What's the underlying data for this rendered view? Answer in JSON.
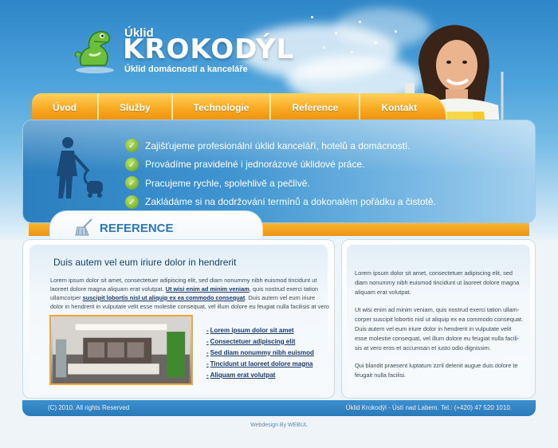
{
  "logo": {
    "small": "Úklid",
    "big": "KROKODÝL",
    "sub": "Úklid domácností a kanceláře"
  },
  "nav": [
    "Úvod",
    "Služby",
    "Technologie",
    "Reference",
    "Kontakt"
  ],
  "features": [
    "Zajišťujeme profesionální úklid kanceláří, hotelů a domácností.",
    "Provádíme pravidelné i jednorázové úklidové práce.",
    "Pracujeme rychle, spolehlivě a pečlivě.",
    "Zakládáme si na dodržování termínů a dokonalém pořádku a čistotě."
  ],
  "section_title": "REFERENCE",
  "left": {
    "heading": "Duis autem vel eum iriure dolor in hendrerit",
    "para_1": "Lorem ipsum dolor sit amet, consectetuer adipiscing elit, sed diam nonummy nibh euismod tincidunt ut laoreet dolore magna aliquam erat volutpat. ",
    "link_1": "Ut wisi enim ad minim veniam",
    "para_2": ", quis nostrud exerci tation ullamcorper ",
    "link_2": "suscipit lobortis nisl ut aliquip ex ea commodo consequat",
    "para_3": ". Duis autem vel eum iriure dolor in hendrerit in vulputate velit esse molestie consequat, vel illum dolore eu feugiat nulla facilisis at vero",
    "links": [
      "Lorem ipsum dolor sit amet",
      "Consectetuer adipiscing elit",
      "Sed diam nonummy nibh euismod",
      "Tincidunt ut laoreet dolore magna",
      "Aliquam erat volutpat"
    ]
  },
  "right": {
    "p1": "Lorem ipsum dolor sit amet, consectetuer adipiscing elit, sed diam nonummy nibh euismod tincidunt ut laoreet dolore magna aliquam erat volutpat.",
    "p2": "Ut wisi enim ad minim veniam, quis nostrud exerci tation ullam-corper suscipit lobortis nisl ut aliquip ex ea commodo consequat. Duis autem vel eum iriure dolor in hendrerit in vulputate velit esse molestie consequat, vel illum dolore eu feugiat nulla facili-sis at vero eros et accumsan et iusto odio dignissim.",
    "p3": "Qui blandit praesent luptatum zzril delenit augue duis dolore te feugait nulla facilisi."
  },
  "footer": {
    "left": "(C) 2010. All rights Reserved",
    "right": "Úklid Krokodýl - Ústí nad Labem. Tel.: (+420) 47 520 1010."
  },
  "credit": "Webdesign By WEBUL",
  "colors": {
    "sky": "#4da3db",
    "accent_orange": "#f7a820",
    "link_blue": "#1a3a6a",
    "title_blue": "#2d7ab8"
  }
}
